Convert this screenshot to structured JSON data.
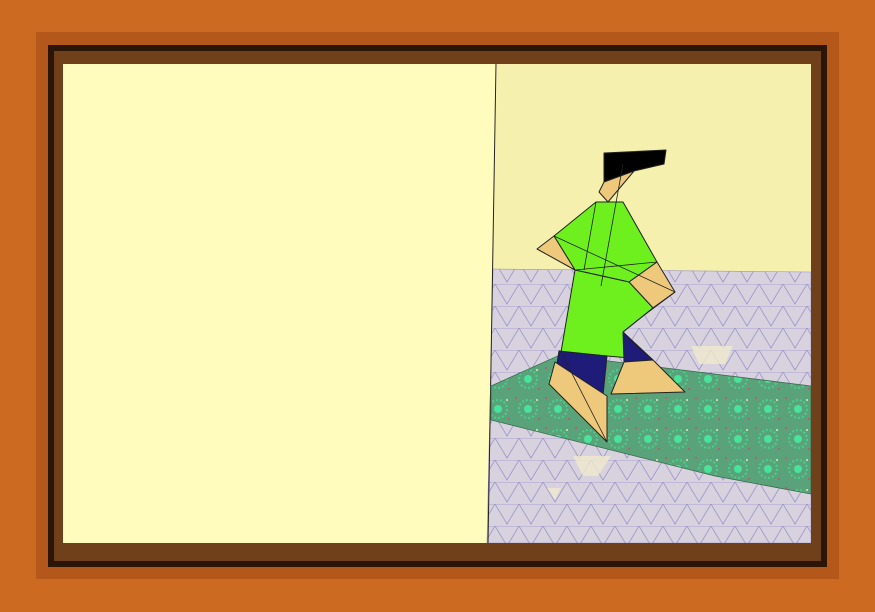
{
  "scene": {
    "panel_left_color": "#fffcbe",
    "wall_color": "#f5f0ad",
    "floor_color": "#d8d1de",
    "mat_color": "#6cc28e",
    "character": {
      "tunic_color": "#6ef01e",
      "skin_color": "#eec97b",
      "hair_color": "#000000",
      "pants_color": "#1e1c78"
    }
  },
  "frame": {
    "outer_color": "#cb6a20",
    "inner_color": "#70401a"
  }
}
